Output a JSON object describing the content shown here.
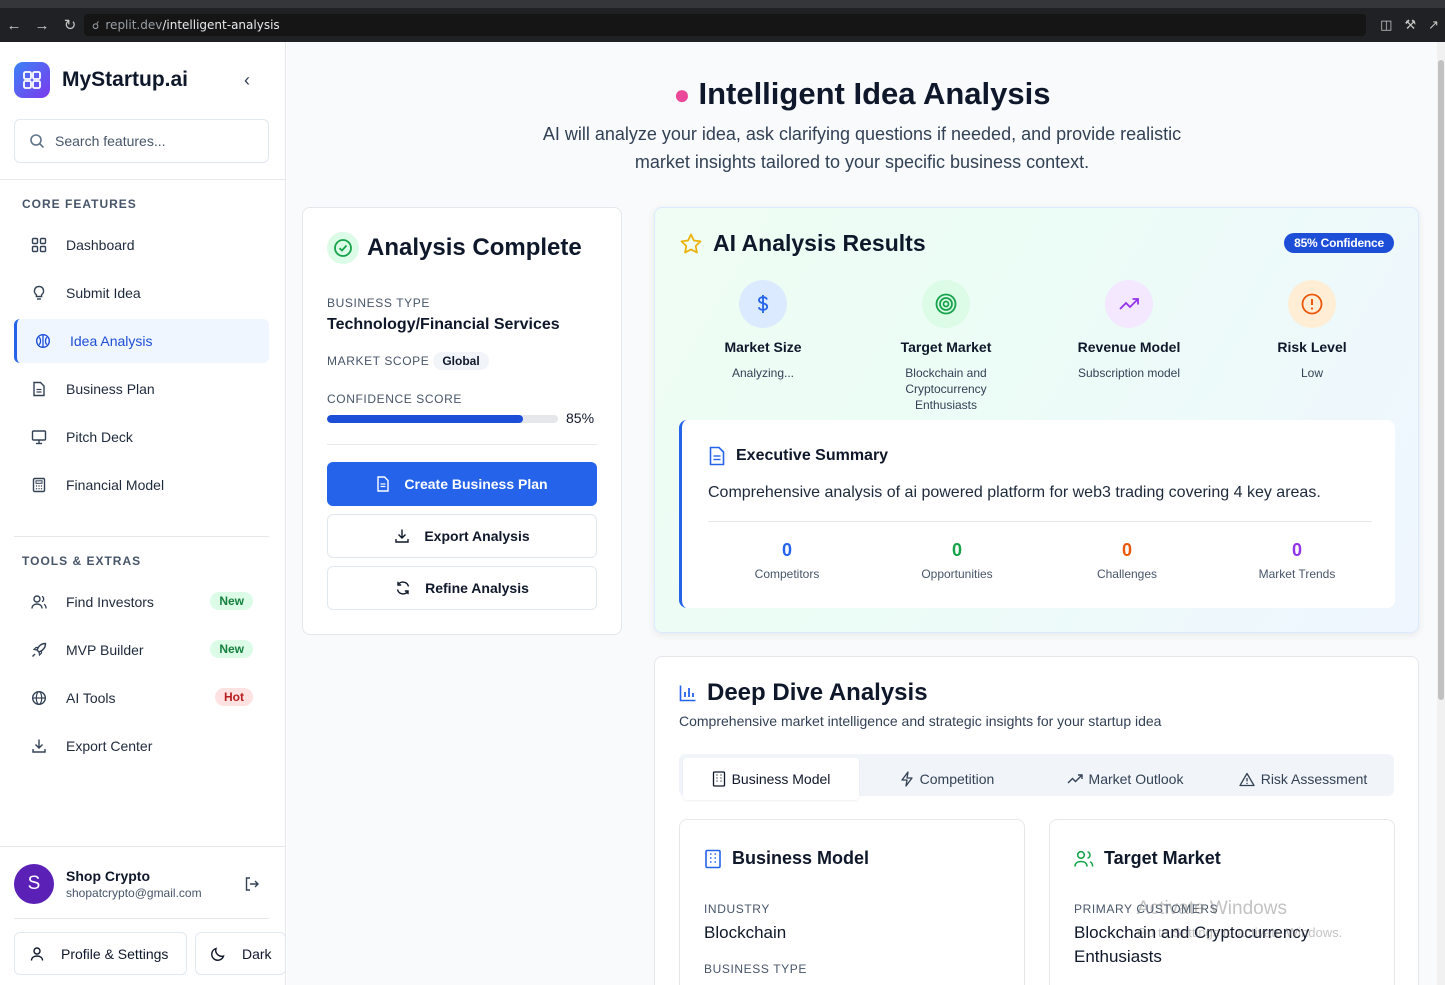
{
  "browser": {
    "url_host": "replit.dev",
    "url_path": "/intelligent-analysis"
  },
  "sidebar": {
    "brand": "MyStartup.ai",
    "search_placeholder": "Search features...",
    "core_label": "CORE FEATURES",
    "core_items": [
      {
        "label": "Dashboard",
        "icon": "grid-icon"
      },
      {
        "label": "Submit Idea",
        "icon": "lightbulb-icon"
      },
      {
        "label": "Idea Analysis",
        "icon": "brain-icon",
        "active": true
      },
      {
        "label": "Business Plan",
        "icon": "document-icon"
      },
      {
        "label": "Pitch Deck",
        "icon": "presentation-icon"
      },
      {
        "label": "Financial Model",
        "icon": "calculator-icon"
      }
    ],
    "tools_label": "TOOLS & EXTRAS",
    "tools_items": [
      {
        "label": "Find Investors",
        "icon": "users-icon",
        "badge": "New"
      },
      {
        "label": "MVP Builder",
        "icon": "rocket-icon",
        "badge": "New"
      },
      {
        "label": "AI Tools",
        "icon": "globe-icon",
        "badge": "Hot"
      },
      {
        "label": "Export Center",
        "icon": "download-icon"
      }
    ],
    "user": {
      "initial": "S",
      "name": "Shop Crypto",
      "email": "shopatcrypto@gmail.com"
    },
    "profile_label": "Profile & Settings",
    "theme_label": "Dark"
  },
  "hero": {
    "title": "Intelligent Idea Analysis",
    "subtitle": "AI will analyze your idea, ask clarifying questions if needed, and provide realistic market insights tailored to your specific business context."
  },
  "analysis_card": {
    "title": "Analysis Complete",
    "business_type_label": "BUSINESS TYPE",
    "business_type": "Technology/Financial Services",
    "market_scope_label": "MARKET SCOPE",
    "market_scope": "Global",
    "confidence_label": "CONFIDENCE SCORE",
    "confidence_value": "85%",
    "confidence_fraction": 0.85,
    "create_plan": "Create Business Plan",
    "export": "Export Analysis",
    "refine": "Refine Analysis"
  },
  "results": {
    "title": "AI Analysis Results",
    "confidence_badge": "85% Confidence",
    "metrics": [
      {
        "title": "Market Size",
        "desc": "Analyzing...",
        "icon": "dollar-icon",
        "color": "#2563eb",
        "bg": "#dbeafe"
      },
      {
        "title": "Target Market",
        "desc": "Blockchain and Cryptocurrency Enthusiasts",
        "icon": "target-icon",
        "color": "#16a34a",
        "bg": "#dcfce7"
      },
      {
        "title": "Revenue Model",
        "desc": "Subscription model",
        "icon": "trending-up-icon",
        "color": "#9333ea",
        "bg": "#f3e8ff"
      },
      {
        "title": "Risk Level",
        "desc": "Low",
        "icon": "alert-circle-icon",
        "color": "#ea580c",
        "bg": "#ffedd5"
      }
    ],
    "exec_title": "Executive Summary",
    "exec_text": "Comprehensive analysis of ai powered platform for web3 trading covering 4 key areas.",
    "stats": [
      {
        "value": "0",
        "label": "Competitors",
        "color": "#2563eb"
      },
      {
        "value": "0",
        "label": "Opportunities",
        "color": "#16a34a"
      },
      {
        "value": "0",
        "label": "Challenges",
        "color": "#ea580c"
      },
      {
        "value": "0",
        "label": "Market Trends",
        "color": "#9333ea"
      }
    ]
  },
  "deep_dive": {
    "title": "Deep Dive Analysis",
    "subtitle": "Comprehensive market intelligence and strategic insights for your startup idea",
    "tabs": [
      {
        "label": "Business Model",
        "icon": "building-icon",
        "active": true
      },
      {
        "label": "Competition",
        "icon": "zap-icon"
      },
      {
        "label": "Market Outlook",
        "icon": "trending-up-icon"
      },
      {
        "label": "Risk Assessment",
        "icon": "warning-icon"
      }
    ],
    "business_model": {
      "title": "Business Model",
      "industry_label": "INDUSTRY",
      "industry": "Blockchain",
      "business_type_label": "BUSINESS TYPE"
    },
    "target_market": {
      "title": "Target Market",
      "primary_label": "PRIMARY CUSTOMERS",
      "primary": "Blockchain and Cryptocurrency Enthusiasts"
    }
  },
  "watermark": {
    "line1": "Activate Windows",
    "line2": "Go to Settings to activate Windows."
  }
}
